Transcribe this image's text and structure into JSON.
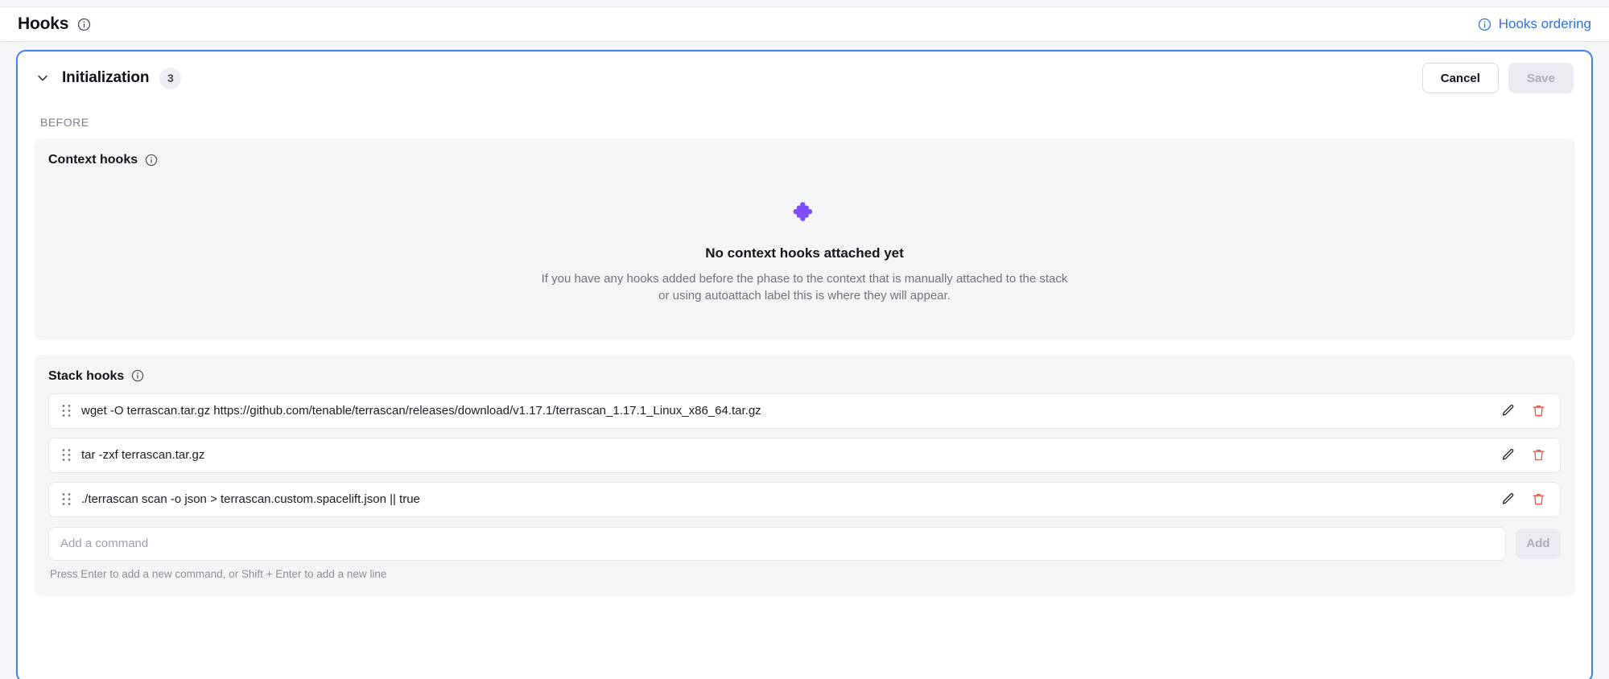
{
  "header": {
    "title": "Hooks",
    "info_icon": "info-circle-icon",
    "ordering_link": {
      "label": "Hooks ordering",
      "icon": "info-circle-icon",
      "color": "#2f6fe4"
    }
  },
  "panel": {
    "border_color": "#3c7ff0",
    "chevron_icon": "chevron-down-icon",
    "section_title": "Initialization",
    "count_badge": "3",
    "cancel_label": "Cancel",
    "save_label": "Save",
    "save_disabled": true,
    "phase_label": "BEFORE",
    "context_hooks": {
      "title": "Context hooks",
      "info_icon": "info-circle-icon",
      "empty_icon": "puzzle-piece-icon",
      "empty_icon_color": "#7c4dfb",
      "empty_title": "No context hooks attached yet",
      "empty_desc_line1": "If you have any hooks added before the phase to the context that is manually attached to the stack",
      "empty_desc_line2": "or using autoattach label this is where they will appear."
    },
    "stack_hooks": {
      "title": "Stack hooks",
      "info_icon": "info-circle-icon",
      "commands": [
        {
          "text": "wget -O terrascan.tar.gz https://github.com/tenable/terrascan/releases/download/v1.17.1/terrascan_1.17.1_Linux_x86_64.tar.gz",
          "drag_icon": "drag-handle-icon",
          "edit_icon": "pencil-icon",
          "delete_icon": "trash-icon"
        },
        {
          "text": "tar -zxf terrascan.tar.gz",
          "drag_icon": "drag-handle-icon",
          "edit_icon": "pencil-icon",
          "delete_icon": "trash-icon"
        },
        {
          "text": "./terrascan scan -o json > terrascan.custom.spacelift.json || true",
          "drag_icon": "drag-handle-icon",
          "edit_icon": "pencil-icon",
          "delete_icon": "trash-icon"
        }
      ],
      "add_input_placeholder": "Add a command",
      "add_input_value": "",
      "add_button_label": "Add",
      "add_button_disabled": true,
      "helper_text": "Press Enter to add a new command, or Shift + Enter to add a new line"
    }
  },
  "colors": {
    "accent_blue": "#3c7ff0",
    "link_blue": "#2f6fe4",
    "delete_red": "#e8574a",
    "puzzle_purple": "#7c4dfb"
  }
}
